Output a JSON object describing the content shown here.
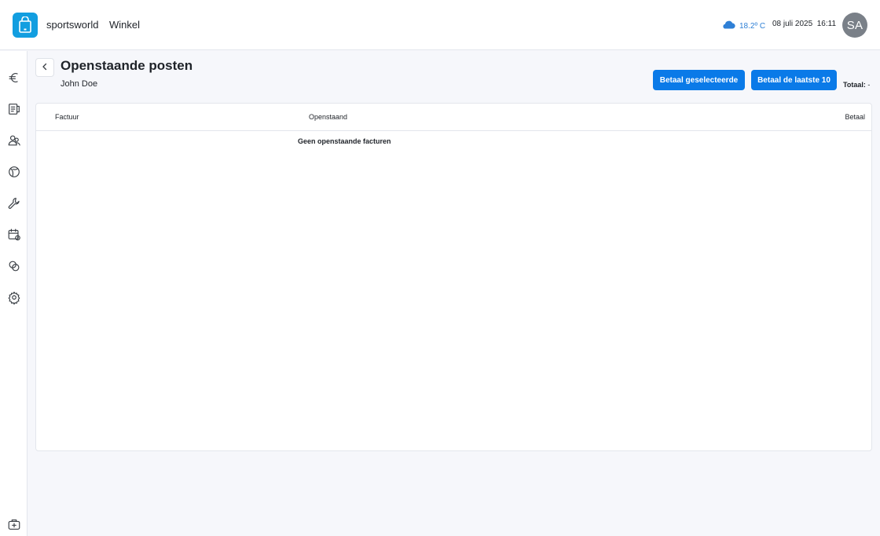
{
  "header": {
    "brand": "sportsworld",
    "section": "Winkel",
    "weather": {
      "icon": "cloud-icon",
      "temperature": "18.2º C"
    },
    "date": "08 juli 2025",
    "time": "16:11",
    "avatar_initials": "SA"
  },
  "sidebar": {
    "items": [
      {
        "icon": "euro-icon"
      },
      {
        "icon": "receipt-icon"
      },
      {
        "icon": "users-icon"
      },
      {
        "icon": "ball-icon"
      },
      {
        "icon": "wrench-icon"
      },
      {
        "icon": "calendar-icon"
      },
      {
        "icon": "rings-icon"
      },
      {
        "icon": "gear-icon"
      }
    ],
    "bottom_icon": "toolbox-icon"
  },
  "page": {
    "title": "Openstaande posten",
    "customer": "John Doe",
    "buttons": {
      "pay_selected": "Betaal geselecteerde",
      "pay_last_10": "Betaal de laatste 10"
    },
    "total_label": "Totaal:",
    "total_value": "-"
  },
  "table": {
    "columns": [
      "Factuur",
      "Openstaand",
      "Betaal"
    ],
    "rows": [],
    "empty_message": "Geen openstaande facturen"
  },
  "colors": {
    "accent": "#0a7ae8",
    "logo": "#129ee0",
    "weather": "#2f80d6",
    "avatar": "#7a8088",
    "background": "#f6f7fb"
  }
}
